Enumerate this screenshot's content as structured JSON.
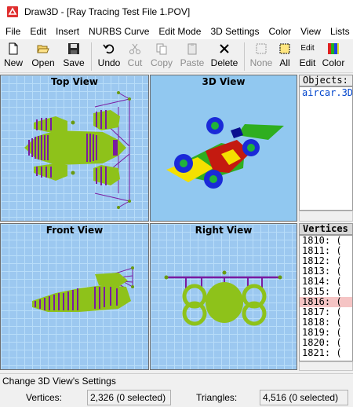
{
  "window": {
    "title": "Draw3D - [Ray Tracing Test File 1.POV]"
  },
  "menu": [
    "File",
    "Edit",
    "Insert",
    "NURBS Curve",
    "Edit Mode",
    "3D Settings",
    "Color",
    "View",
    "Lists"
  ],
  "toolbar": {
    "new": "New",
    "open": "Open",
    "save": "Save",
    "undo": "Undo",
    "cut": "Cut",
    "copy": "Copy",
    "paste": "Paste",
    "delete": "Delete",
    "none": "None",
    "all": "All",
    "edit": "Edit",
    "edit_icon_text": "Edit",
    "color": "Color"
  },
  "views": {
    "top": "Top View",
    "three_d": "3D View",
    "front": "Front View",
    "right": "Right View"
  },
  "objects_panel": {
    "header": "Objects:",
    "items": [
      "aircar.3D"
    ]
  },
  "vertices_panel": {
    "header": "Vertices",
    "rows": [
      "1810:  (",
      "1811:  (",
      "1812:  (",
      "1813:  (",
      "1814:  (",
      "1815:  (",
      "1816:  (",
      "1817:  (",
      "1818:  (",
      "1819:  (",
      "1820:  (",
      "1821:  ("
    ],
    "selected_row": "1816:  ("
  },
  "status": {
    "message": "Change 3D View's Settings",
    "vertices_label": "Vertices:",
    "vertices_value": "2,326   (0 selected)",
    "triangles_label": "Triangles:",
    "triangles_value": "4,516   (0 selected)"
  },
  "colors": {
    "mesh_green": "#8ec21a",
    "edge_purple": "#7a1aa0",
    "selection_pink": "#f5c4c4",
    "viewport_blue": "#9cc8f0"
  }
}
